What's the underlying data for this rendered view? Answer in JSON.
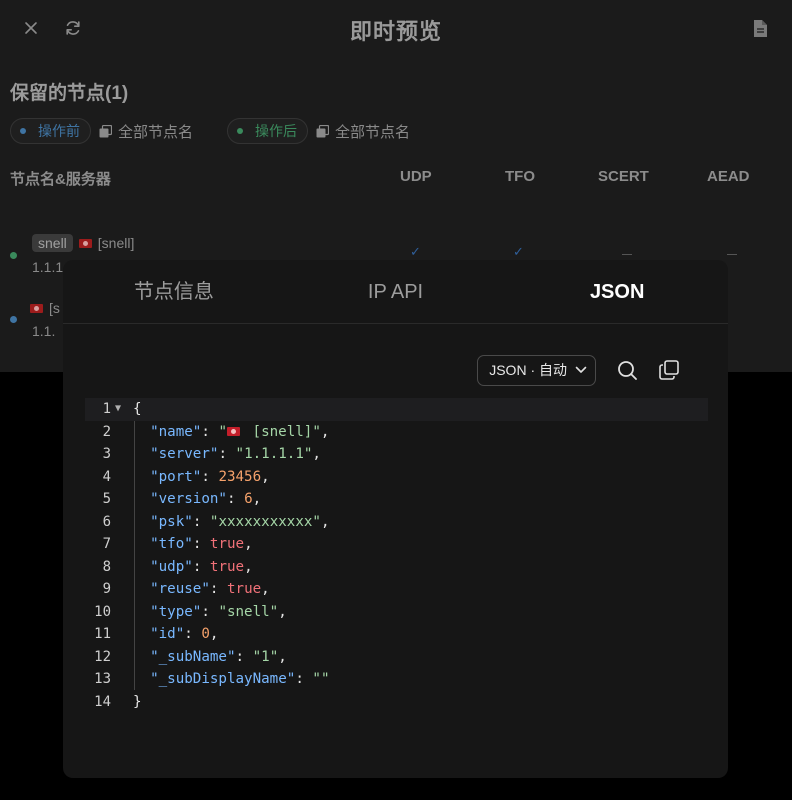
{
  "header": {
    "title": "即时预览",
    "close_icon": "close-icon",
    "refresh_icon": "refresh-icon",
    "file_icon": "file-icon"
  },
  "section": {
    "title": "保留的节点(1)"
  },
  "filters": {
    "before_label": "操作前",
    "before_copy_label": "全部节点名",
    "after_label": "操作后",
    "after_copy_label": "全部节点名"
  },
  "columns": {
    "name_server": "节点名&服务器",
    "udp": "UDP",
    "tfo": "TFO",
    "scert": "SCERT",
    "aead": "AEAD"
  },
  "nodes": [
    {
      "tag": "snell",
      "name": "[snell]",
      "addr": "1.1.1."
    },
    {
      "tag": "",
      "name": "[s",
      "addr": "1.1."
    }
  ],
  "modal": {
    "tabs": [
      {
        "label": "节点信息",
        "active": false
      },
      {
        "label": "IP API",
        "active": false
      },
      {
        "label": "JSON",
        "active": true
      }
    ],
    "mode_select": "JSON · 自动",
    "search_icon": "search-icon",
    "copy_icon": "copy-icon"
  },
  "json_lines": [
    {
      "no": "1",
      "fold": true,
      "tokens": [
        [
          "p",
          "{"
        ]
      ]
    },
    {
      "no": "2",
      "tokens": [
        [
          "k",
          "\"name\""
        ],
        [
          "p",
          ": "
        ],
        [
          "s",
          "\""
        ],
        [
          "flag",
          ""
        ],
        [
          "s",
          " [snell]\""
        ],
        [
          "p",
          ","
        ]
      ]
    },
    {
      "no": "3",
      "tokens": [
        [
          "k",
          "\"server\""
        ],
        [
          "p",
          ": "
        ],
        [
          "s",
          "\"1.1.1.1\""
        ],
        [
          "p",
          ","
        ]
      ]
    },
    {
      "no": "4",
      "tokens": [
        [
          "k",
          "\"port\""
        ],
        [
          "p",
          ": "
        ],
        [
          "n",
          "23456"
        ],
        [
          "p",
          ","
        ]
      ]
    },
    {
      "no": "5",
      "tokens": [
        [
          "k",
          "\"version\""
        ],
        [
          "p",
          ": "
        ],
        [
          "n",
          "6"
        ],
        [
          "p",
          ","
        ]
      ]
    },
    {
      "no": "6",
      "tokens": [
        [
          "k",
          "\"psk\""
        ],
        [
          "p",
          ": "
        ],
        [
          "s",
          "\"xxxxxxxxxxx\""
        ],
        [
          "p",
          ","
        ]
      ]
    },
    {
      "no": "7",
      "tokens": [
        [
          "k",
          "\"tfo\""
        ],
        [
          "p",
          ": "
        ],
        [
          "b",
          "true"
        ],
        [
          "p",
          ","
        ]
      ]
    },
    {
      "no": "8",
      "tokens": [
        [
          "k",
          "\"udp\""
        ],
        [
          "p",
          ": "
        ],
        [
          "b",
          "true"
        ],
        [
          "p",
          ","
        ]
      ]
    },
    {
      "no": "9",
      "tokens": [
        [
          "k",
          "\"reuse\""
        ],
        [
          "p",
          ": "
        ],
        [
          "b",
          "true"
        ],
        [
          "p",
          ","
        ]
      ]
    },
    {
      "no": "10",
      "tokens": [
        [
          "k",
          "\"type\""
        ],
        [
          "p",
          ": "
        ],
        [
          "s",
          "\"snell\""
        ],
        [
          "p",
          ","
        ]
      ]
    },
    {
      "no": "11",
      "tokens": [
        [
          "k",
          "\"id\""
        ],
        [
          "p",
          ": "
        ],
        [
          "n",
          "0"
        ],
        [
          "p",
          ","
        ]
      ]
    },
    {
      "no": "12",
      "tokens": [
        [
          "k",
          "\"_subName\""
        ],
        [
          "p",
          ": "
        ],
        [
          "s",
          "\"1\""
        ],
        [
          "p",
          ","
        ]
      ]
    },
    {
      "no": "13",
      "tokens": [
        [
          "k",
          "\"_subDisplayName\""
        ],
        [
          "p",
          ": "
        ],
        [
          "s",
          "\"\""
        ]
      ]
    },
    {
      "no": "14",
      "tokens": [
        [
          "p",
          "}"
        ]
      ]
    }
  ],
  "colors": {
    "key": "#79b8ff",
    "string": "#a5d6a7",
    "number": "#f6a26b",
    "boolean": "#f07178",
    "before_accent": "#3f74a3",
    "after_accent": "#3a8a5c"
  }
}
